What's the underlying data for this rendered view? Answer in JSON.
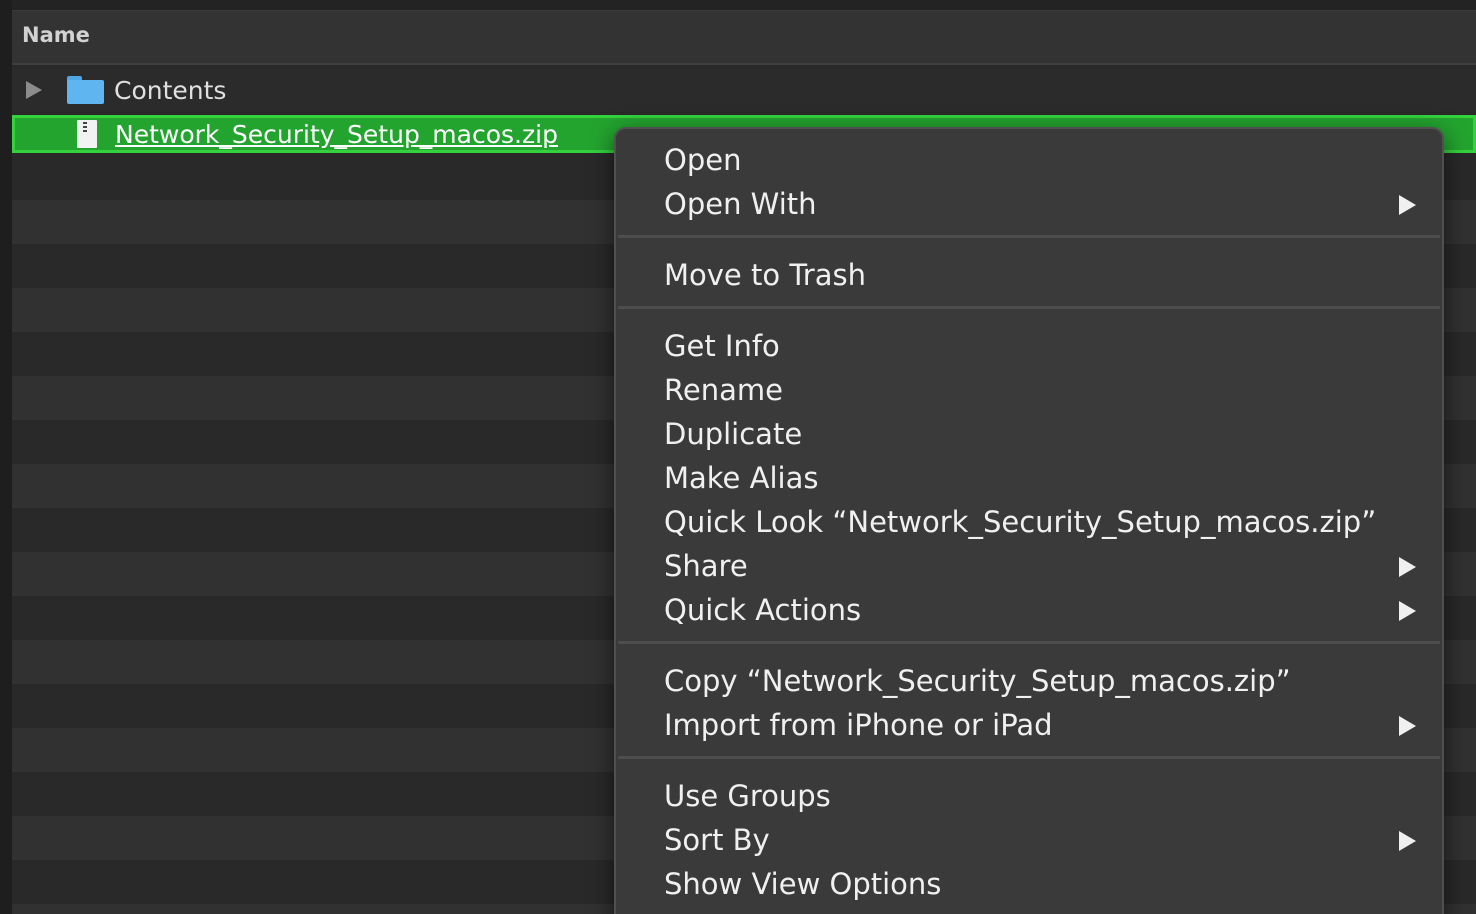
{
  "list": {
    "column_header": "Name",
    "rows": [
      {
        "label": "Contents",
        "icon": "folder-icon",
        "expandable": true
      },
      {
        "label": "Network_Security_Setup_macos.zip",
        "icon": "zip-file-icon",
        "selected": true
      }
    ]
  },
  "colors": {
    "selection": "#23a42f",
    "selection_border": "#35d13f",
    "menu_background": "#3a3a3a",
    "folder": "#5fb5ef"
  },
  "context_menu": {
    "groups": [
      [
        {
          "label": "Open",
          "submenu": false
        },
        {
          "label": "Open With",
          "submenu": true
        }
      ],
      [
        {
          "label": "Move to Trash",
          "submenu": false
        }
      ],
      [
        {
          "label": "Get Info",
          "submenu": false
        },
        {
          "label": "Rename",
          "submenu": false
        },
        {
          "label": "Duplicate",
          "submenu": false
        },
        {
          "label": "Make Alias",
          "submenu": false
        },
        {
          "label": "Quick Look “Network_Security_Setup_macos.zip”",
          "submenu": false
        },
        {
          "label": "Share",
          "submenu": true
        },
        {
          "label": "Quick Actions",
          "submenu": true
        }
      ],
      [
        {
          "label": "Copy “Network_Security_Setup_macos.zip”",
          "submenu": false
        },
        {
          "label": "Import from iPhone or iPad",
          "submenu": true
        }
      ],
      [
        {
          "label": "Use Groups",
          "submenu": false
        },
        {
          "label": "Sort By",
          "submenu": true
        },
        {
          "label": "Show View Options",
          "submenu": false
        }
      ]
    ]
  }
}
